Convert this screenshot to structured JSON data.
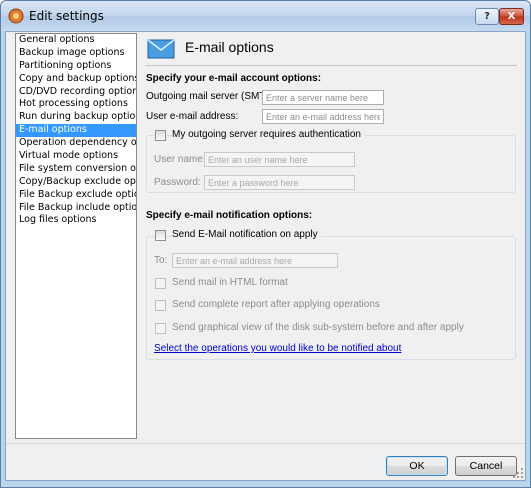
{
  "window": {
    "title": "Edit settings",
    "help_label": "?",
    "close_label": "X"
  },
  "sidebar": {
    "items": [
      {
        "label": "General options"
      },
      {
        "label": "Backup image options"
      },
      {
        "label": "Partitioning options"
      },
      {
        "label": "Copy and backup options"
      },
      {
        "label": "CD/DVD recording options"
      },
      {
        "label": "Hot processing options"
      },
      {
        "label": "Run during backup options"
      },
      {
        "label": "E-mail options",
        "selected": true
      },
      {
        "label": "Operation dependency options"
      },
      {
        "label": "Virtual mode options"
      },
      {
        "label": "File system conversion options"
      },
      {
        "label": "Copy/Backup exclude options"
      },
      {
        "label": "File Backup exclude options"
      },
      {
        "label": "File Backup include options"
      },
      {
        "label": "Log files options"
      }
    ]
  },
  "main": {
    "title": "E-mail options",
    "header_icon": "envelope-icon",
    "account_section": {
      "title": "Specify your e-mail account options:",
      "smtp_label": "Outgoing mail server (SMTP):",
      "smtp_placeholder": "Enter a server name here",
      "email_label": "User e-mail address:",
      "email_placeholder": "Enter an e-mail address here",
      "auth_label": "My outgoing server requires authentication",
      "username_label": "User name:",
      "username_placeholder": "Enter an user name here",
      "password_label": "Password:",
      "password_placeholder": "Enter a password here"
    },
    "notification_section": {
      "title": "Specify e-mail notification options:",
      "send_label": "Send E-Mail notification on apply",
      "to_label": "To:",
      "to_placeholder": "Enter an e-mail address here",
      "html_label": "Send mail in HTML format",
      "report_label": "Send complete report after applying operations",
      "graphical_label": "Send graphical view of the disk sub-system before and after apply",
      "link_label": "Select the operations you would like to be notified about"
    }
  },
  "footer": {
    "ok_label": "OK",
    "cancel_label": "Cancel"
  },
  "colors": {
    "selection": "#3399ff",
    "link": "#0000cc",
    "title_bar": "#c0d4ec"
  }
}
